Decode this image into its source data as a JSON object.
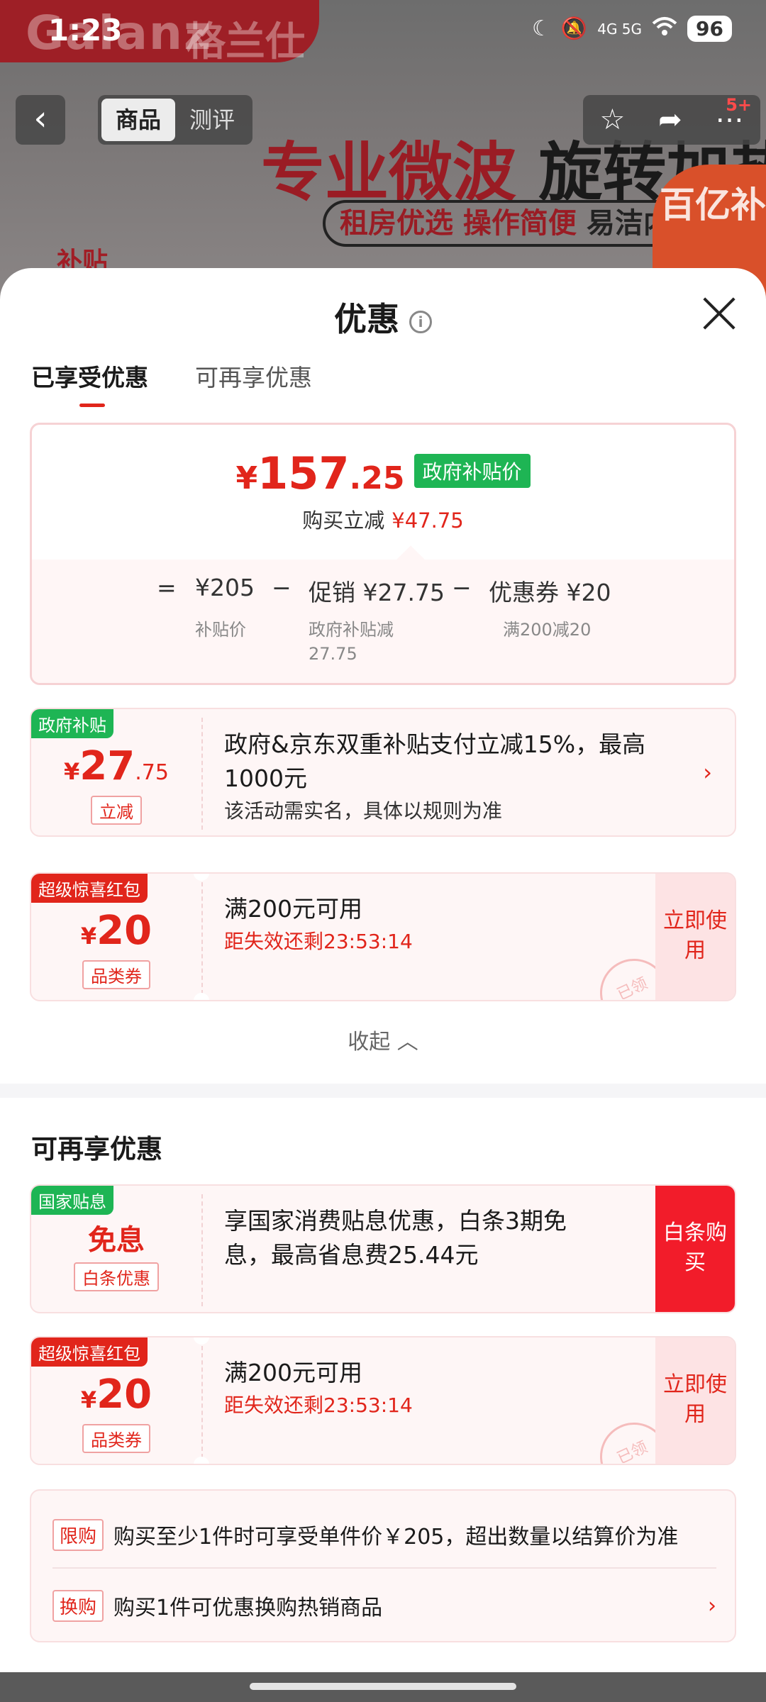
{
  "status": {
    "time": "1:23",
    "network": "4G  5G",
    "battery": "96"
  },
  "background": {
    "brand": "Galanz",
    "brand_cn": "格兰仕",
    "headline_red": "专业微波",
    "headline_dark": "旋转加热",
    "subline_red": "租房优选 操作简便",
    "subline_dark": "易洁内",
    "badge": "百亿补贴",
    "left_tag": "补贴"
  },
  "topbar": {
    "back": "‹",
    "tabs": [
      "商品",
      "测评"
    ],
    "badge": "5+"
  },
  "sheet": {
    "title": "优惠",
    "info_icon": "i",
    "tabs": [
      "已享受优惠",
      "可再享优惠"
    ],
    "summary": {
      "yen": "¥",
      "price_int": "157",
      "price_dec": ".25",
      "price_tag": "政府补贴价",
      "reduce_label": "购买立减",
      "reduce_value": "¥47.75",
      "eq": "=",
      "base_value": "¥205",
      "base_label": "补贴价",
      "minus1": "−",
      "promo_value": "促销 ¥27.75",
      "promo_label": "政府补贴减",
      "promo_label2": "27.75",
      "minus2": "−",
      "coupon_value": "优惠券 ¥20",
      "coupon_label": "满200减20"
    },
    "enjoyed": [
      {
        "ribbon": "政府补贴",
        "yen": "¥",
        "amount": "27",
        "decimal": ".75",
        "chip": "立减",
        "line1": "政府&京东双重补贴支付立减15%，最高1000元",
        "line2": "该活动需实名，具体以规则为准"
      },
      {
        "ribbon": "超级惊喜红包",
        "yen": "¥",
        "amount": "20",
        "chip": "品类券",
        "line1": "满200元可用",
        "line2": "距失效还剩23:53:14",
        "button": "立即使用",
        "stamp": "已领"
      }
    ],
    "collapse": "收起 ︿",
    "more_title": "可再享优惠",
    "more": [
      {
        "ribbon": "国家贴息",
        "free": "免息",
        "chip": "白条优惠",
        "line1": "享国家消费贴息优惠，白条3期免息，最高省息费25.44元",
        "button": "白条购买"
      },
      {
        "ribbon": "超级惊喜红包",
        "yen": "¥",
        "amount": "20",
        "chip": "品类券",
        "line1": "满200元可用",
        "line2": "距失效还剩23:53:14",
        "button": "立即使用",
        "stamp": "已领"
      }
    ],
    "limits": [
      {
        "tag": "限购",
        "text": "购买至少1件时可享受单件价￥205，超出数量以结算价为准"
      },
      {
        "tag": "换购",
        "text": "购买1件可优惠换购热销商品",
        "arrow": "›"
      }
    ]
  }
}
